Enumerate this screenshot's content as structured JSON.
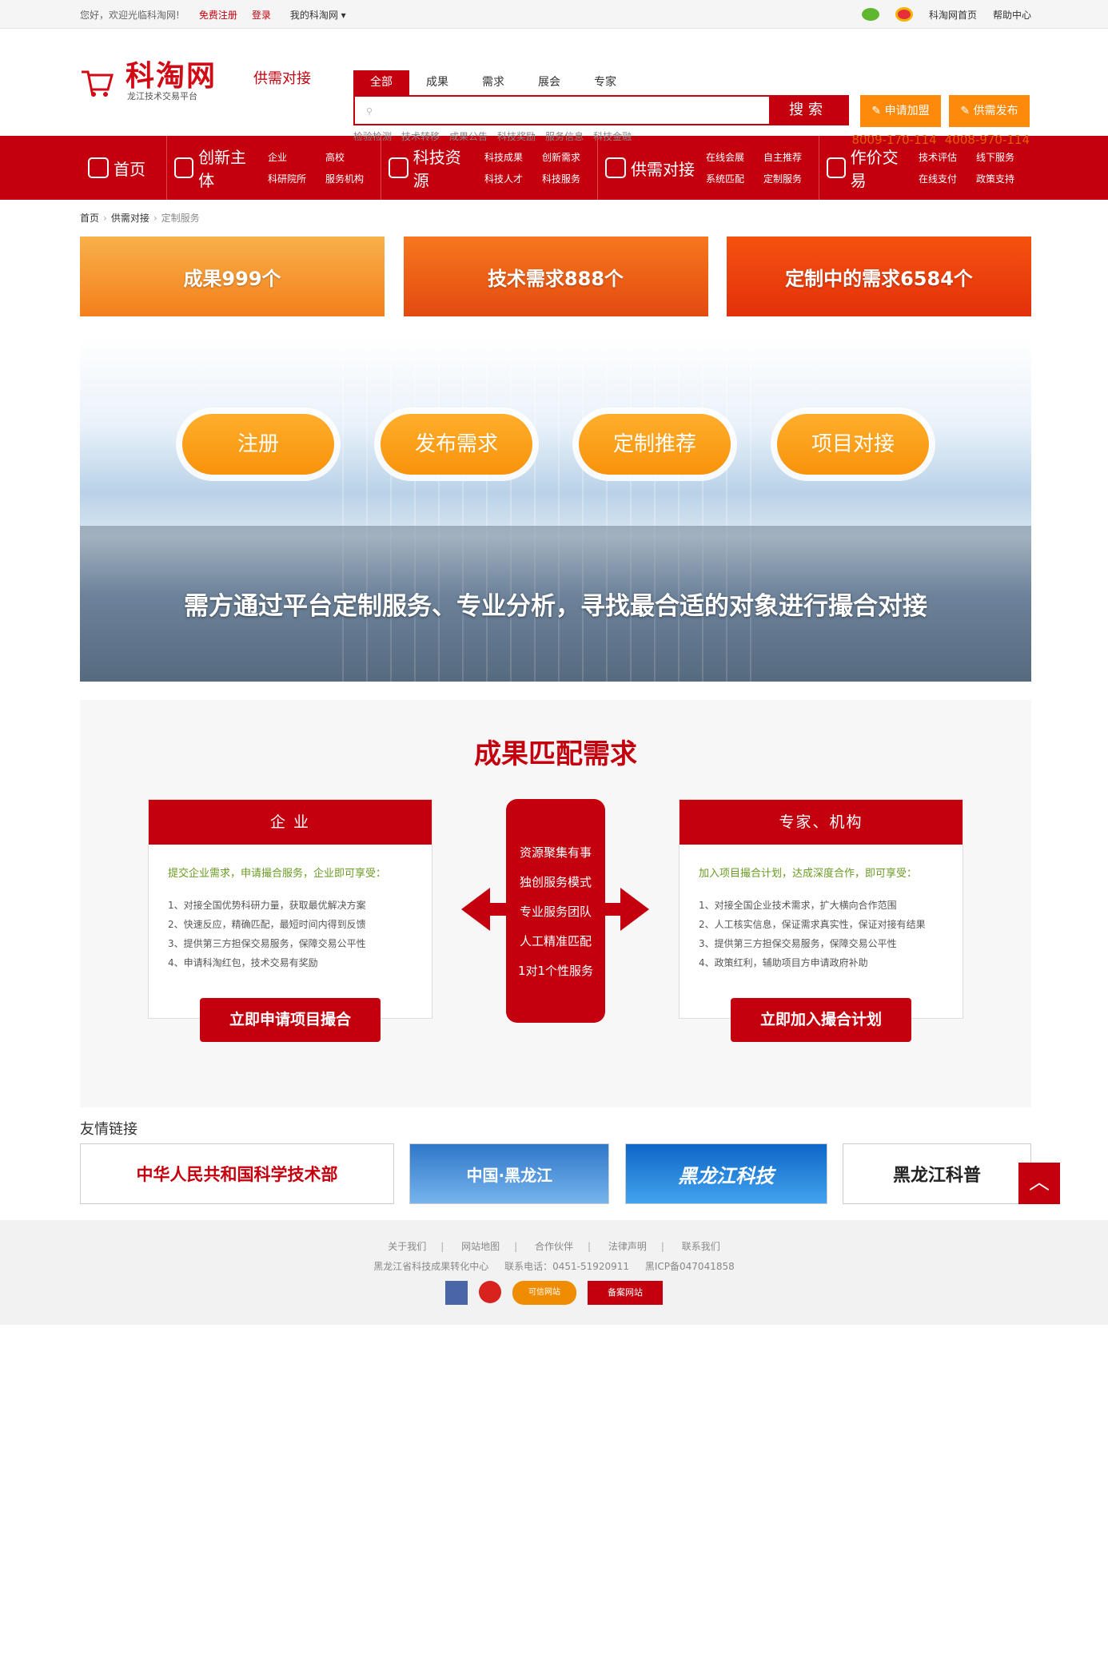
{
  "topbar": {
    "welcome": "您好，欢迎光临科淘网!",
    "register": "免费注册",
    "login": "登录",
    "my": "我的科淘网 ▾",
    "home": "科淘网首页",
    "help": "帮助中心"
  },
  "logo": {
    "title": "科淘网",
    "subtitle": "龙江技术交易平台",
    "tag": "供需对接"
  },
  "search": {
    "tabs": [
      "全部",
      "成果",
      "需求",
      "展会",
      "专家"
    ],
    "button": "搜索",
    "placeholder": "",
    "hot": [
      "检验检测",
      "技术转移",
      "成果公告",
      "科技奖励",
      "服务信息",
      "科技金融"
    ]
  },
  "header_buttons": {
    "join": "申请加盟",
    "publish": "供需发布"
  },
  "phones": [
    "8009-170-114",
    "4008-970-114"
  ],
  "nav": [
    {
      "label": "首页",
      "subs": []
    },
    {
      "label": "创新主体",
      "subs": [
        "企业",
        "高校",
        "科研院所",
        "服务机构"
      ]
    },
    {
      "label": "科技资源",
      "subs": [
        "科技成果",
        "创新需求",
        "科技人才",
        "科技服务"
      ]
    },
    {
      "label": "供需对接",
      "subs": [
        "在线会展",
        "自主推荐",
        "系统匹配",
        "定制服务"
      ]
    },
    {
      "label": "作价交易",
      "subs": [
        "技术评估",
        "线下服务",
        "在线支付",
        "政策支持"
      ]
    }
  ],
  "breadcrumb": [
    "首页",
    "供需对接",
    "定制服务"
  ],
  "stats": [
    "成果999个",
    "技术需求888个",
    "定制中的需求6584个"
  ],
  "hero": {
    "buttons": [
      "注册",
      "发布需求",
      "定制推荐",
      "项目对接"
    ],
    "slogan": "需方通过平台定制服务、专业分析，寻找最合适的对象进行撮合对接"
  },
  "match": {
    "title": "成果匹配需求",
    "left": {
      "header": "企 业",
      "lead": "提交企业需求，申请撮合服务，企业即可享受：",
      "items": [
        "1、对接全国优势科研力量，获取最优解决方案",
        "2、快速反应，精确匹配，最短时间内得到反馈",
        "3、提供第三方担保交易服务，保障交易公平性",
        "4、申请科淘红包，技术交易有奖励"
      ],
      "button": "立即申请项目撮合"
    },
    "center": [
      "资源聚集有事",
      "独创服务模式",
      "专业服务团队",
      "人工精准匹配",
      "1对1个性服务"
    ],
    "right": {
      "header": "专家、机构",
      "lead": "加入项目撮合计划，达成深度合作，即可享受：",
      "items": [
        "1、对接全国企业技术需求，扩大横向合作范围",
        "2、人工核实信息，保证需求真实性，保证对接有结果",
        "3、提供第三方担保交易服务，保障交易公平性",
        "4、政策红利，辅助项目方申请政府补助"
      ],
      "button": "立即加入撮合计划"
    }
  },
  "links": {
    "title": "友情链接",
    "items": [
      "中华人民共和国科学技术部",
      "中国·黑龙江",
      "黑龙江科技",
      "黑龙江科普"
    ]
  },
  "footer": {
    "nav": [
      "关于我们",
      "网站地图",
      "合作伙伴",
      "法律声明",
      "联系我们"
    ],
    "org": "黑龙江省科技成果转化中心",
    "phone": "联系电话：0451-51920911",
    "icp": "黑ICP备047041858",
    "badge3": "可信网站",
    "badge4": "备案网站"
  },
  "colors": {
    "brand": "#c4000e",
    "accent": "#fe8a0b",
    "green": "#6a9b22"
  }
}
